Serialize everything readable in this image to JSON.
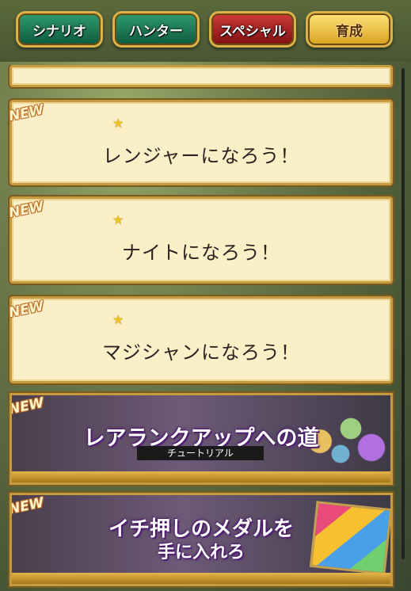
{
  "tabs": [
    {
      "label": "シナリオ"
    },
    {
      "label": "ハンター"
    },
    {
      "label": "スペシャル"
    },
    {
      "label": "育成"
    }
  ],
  "missions": [
    {
      "badge": "NEW",
      "title": "レンジャーになろう！"
    },
    {
      "badge": "NEW",
      "title": "ナイトになろう！"
    },
    {
      "badge": "NEW",
      "title": "マジシャンになろう！"
    }
  ],
  "banners": [
    {
      "badge": "NEW",
      "title": "レアランクアップへの道",
      "subtitle": "チュートリアル"
    },
    {
      "badge": "NEW",
      "title_line1": "イチ押しのメダルを",
      "title_line2": "手に入れろ"
    }
  ],
  "colors": {
    "tab_green": "#1e7a55",
    "tab_red": "#a52020",
    "tab_gold": "#f0c040",
    "card_bg": "#fbefc8",
    "card_border": "#c69a3e",
    "star": "#f2c324"
  }
}
